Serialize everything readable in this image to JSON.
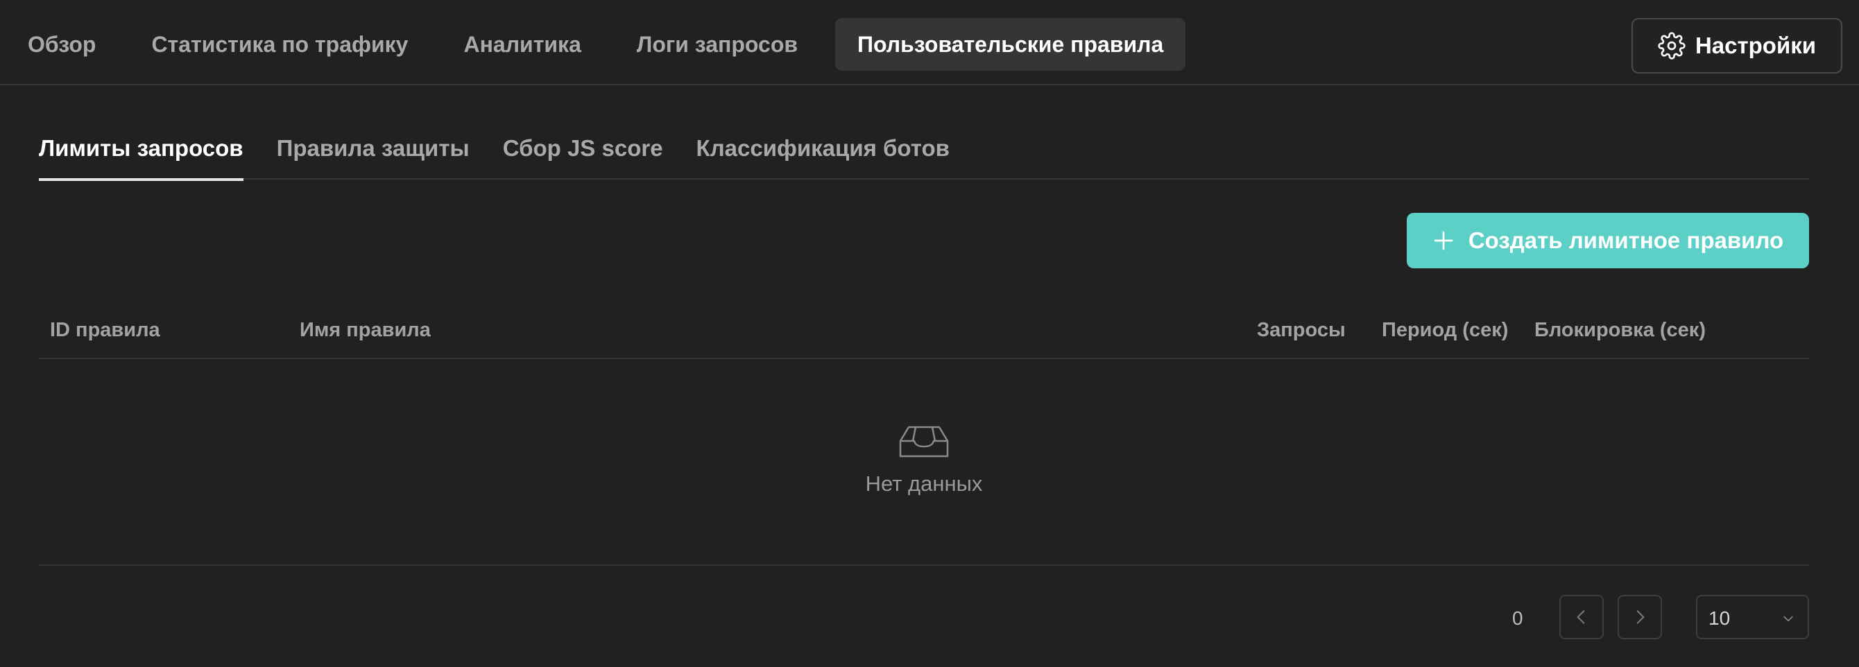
{
  "topnav": {
    "tabs": [
      {
        "label": "Обзор",
        "active": false
      },
      {
        "label": "Статистика по трафику",
        "active": false
      },
      {
        "label": "Аналитика",
        "active": false
      },
      {
        "label": "Логи запросов",
        "active": false
      },
      {
        "label": "Пользовательские правила",
        "active": true
      }
    ],
    "settings_label": "Настройки",
    "settings_icon": "gear-icon"
  },
  "subtabs": [
    {
      "label": "Лимиты запросов",
      "active": true
    },
    {
      "label": "Правила защиты",
      "active": false
    },
    {
      "label": "Сбор JS score",
      "active": false
    },
    {
      "label": "Классификация ботов",
      "active": false
    }
  ],
  "create_button": {
    "label": "Создать лимитное правило",
    "icon": "plus-icon",
    "color": "#5ccfc6"
  },
  "table": {
    "columns": [
      "ID правила",
      "Имя правила",
      "Запросы",
      "Период (сек)",
      "Блокировка (сек)"
    ],
    "rows": [],
    "empty_text": "Нет данных",
    "empty_icon": "empty-inbox-icon"
  },
  "pagination": {
    "total": "0",
    "page_size": "10"
  }
}
